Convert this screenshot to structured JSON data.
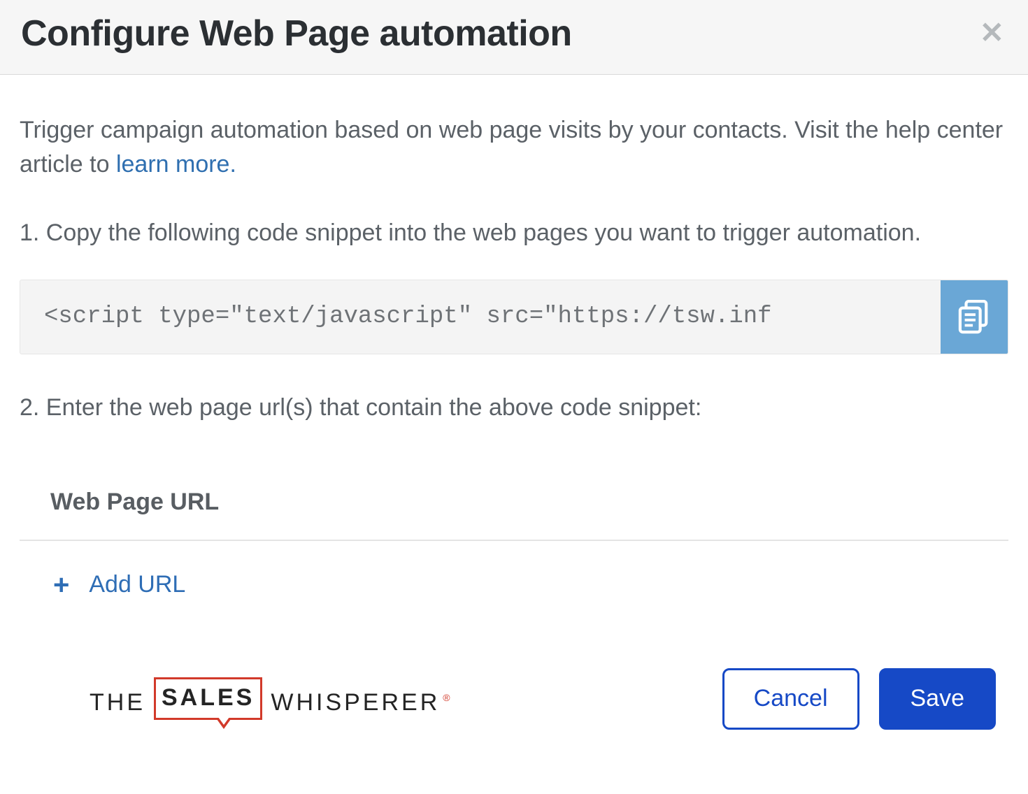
{
  "header": {
    "title": "Configure Web Page automation"
  },
  "intro": {
    "text_before_link": "Trigger campaign automation based on web page visits by your contacts. Visit the help center article to ",
    "link_text": "learn more."
  },
  "steps": {
    "step1": "1. Copy the following code snippet into the web pages you want to trigger automation.",
    "code_snippet": "<script type=\"text/javascript\" src=\"https://tsw.inf",
    "step2": "2. Enter the web page url(s) that contain the above code snippet:"
  },
  "url_section": {
    "heading": "Web Page URL",
    "add_label": "Add URL"
  },
  "logo": {
    "part1": "THE",
    "part2": "SALES",
    "part3": "WHISPERER"
  },
  "footer": {
    "cancel": "Cancel",
    "save": "Save"
  }
}
